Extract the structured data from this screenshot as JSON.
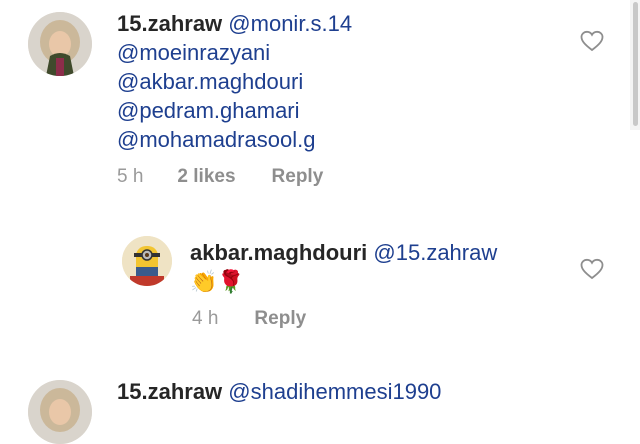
{
  "comments": [
    {
      "username": "15.zahraw",
      "mentions": [
        "@monir.s.14",
        "@moeinrazyani",
        "@akbar.maghdouri",
        "@pedram.ghamari",
        "@mohamadrasool.g"
      ],
      "time": "5 h",
      "likes": "2 likes",
      "reply": "Reply"
    },
    {
      "username": "akbar.maghdouri",
      "mention": "@15.zahraw",
      "emojis": "👏🌹",
      "time": "4 h",
      "reply": "Reply"
    },
    {
      "username": "15.zahraw",
      "mention": "@shadihemmesi1990"
    }
  ],
  "colors": {
    "mention": "#1e3f8f",
    "meta": "#9a9a9a",
    "text": "#262626"
  },
  "icons": [
    "heart-outline-icon",
    "avatar-girl-fur-hood",
    "avatar-cartoon-minion"
  ]
}
